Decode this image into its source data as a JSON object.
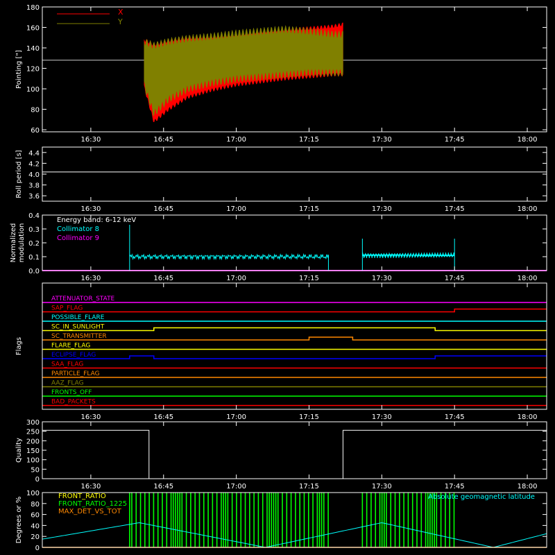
{
  "colors": {
    "background": "#000000",
    "axes": "#ffffff",
    "x_series": "#ff0000",
    "y_series": "#808000",
    "collimator8": "#00ffff",
    "collimator9": "#ff00ff",
    "front_ratio": "#ffff00",
    "front_ratio_1225": "#00ff00",
    "max_det": "#ff8800",
    "geomag": "#00ffff"
  },
  "chart_data": [
    {
      "id": "pointing",
      "type": "line",
      "ylabel": "Pointing [\"]",
      "xlim": [
        "16:20",
        "18:04"
      ],
      "ylim": [
        58,
        180
      ],
      "x_ticks": [
        "16:30",
        "16:45",
        "17:00",
        "17:15",
        "17:30",
        "17:45",
        "18:00"
      ],
      "y_ticks": [
        60,
        80,
        100,
        120,
        140,
        160,
        180
      ],
      "legend": [
        "X",
        "Y"
      ],
      "legend_placement": "top-left",
      "reference_line_y": 128,
      "data_range": [
        "16:41",
        "17:22"
      ],
      "series": [
        {
          "name": "X",
          "color": "#ff0000",
          "x": [
            "16:41",
            "16:43",
            "16:46",
            "16:50",
            "16:55",
            "17:00",
            "17:05",
            "17:10",
            "17:15",
            "17:20",
            "17:22"
          ],
          "upper": [
            150,
            145,
            149,
            152,
            153,
            155,
            158,
            160,
            161,
            163,
            165
          ],
          "lower": [
            100,
            66,
            78,
            90,
            97,
            102,
            105,
            108,
            110,
            112,
            112
          ]
        },
        {
          "name": "Y",
          "color": "#808000",
          "x": [
            "16:41",
            "16:43",
            "16:46",
            "16:50",
            "16:55",
            "17:00",
            "17:05",
            "17:10",
            "17:15",
            "17:20",
            "17:22"
          ],
          "upper": [
            150,
            146,
            150,
            153,
            155,
            158,
            160,
            162,
            160,
            157,
            157
          ],
          "lower": [
            100,
            72,
            86,
            96,
            102,
            106,
            108,
            110,
            112,
            112,
            112
          ]
        }
      ]
    },
    {
      "id": "roll",
      "type": "line",
      "ylabel": "Roll period [s]",
      "xlim": [
        "16:20",
        "18:04"
      ],
      "ylim": [
        3.5,
        4.5
      ],
      "x_ticks": [
        "16:30",
        "16:45",
        "17:00",
        "17:15",
        "17:30",
        "17:45",
        "18:00"
      ],
      "y_ticks": [
        "3.6",
        "3.8",
        "4.0",
        "4.2",
        "4.4"
      ],
      "series": [
        {
          "name": "",
          "x": [
            "16:20",
            "18:04"
          ],
          "values": [
            4.04,
            4.04
          ]
        }
      ]
    },
    {
      "id": "modulation",
      "type": "line",
      "ylabel": "Normalized modulation",
      "xlim": [
        "16:20",
        "18:04"
      ],
      "ylim": [
        0,
        0.4
      ],
      "x_ticks": [
        "16:30",
        "16:45",
        "17:00",
        "17:15",
        "17:30",
        "17:45",
        "18:00"
      ],
      "y_ticks": [
        "0.0",
        "0.1",
        "0.2",
        "0.3",
        "0.4"
      ],
      "annotation": "Energy band: 6-12 keV",
      "legend": [
        "Collimator 8",
        "Collimator 9"
      ],
      "segments": [
        {
          "series": "Collimator 8",
          "start": "16:38",
          "end": "17:19",
          "level": 0.1,
          "spike": 0.33
        },
        {
          "series": "Collimator 8",
          "start": "17:26",
          "end": "17:45",
          "level": 0.11,
          "spike": 0.23
        }
      ],
      "collimator9_level": 0.0
    },
    {
      "id": "flags",
      "type": "line",
      "ylabel": "Flags",
      "xlim": [
        "16:20",
        "18:04"
      ],
      "x_ticks": [
        "16:30",
        "16:45",
        "17:00",
        "17:15",
        "17:30",
        "17:45",
        "18:00"
      ],
      "rows": [
        {
          "name": "ATTENUATOR_STATE",
          "color": "#ff00ff",
          "steps": []
        },
        {
          "name": "SAP_FLAG",
          "color": "#ff0000",
          "steps": [
            [
              "16:38",
              0
            ],
            [
              "17:45",
              1
            ]
          ]
        },
        {
          "name": "POSSIBLE_FLARE",
          "color": "#00ffff",
          "steps": []
        },
        {
          "name": "SC_IN_SUNLIGHT",
          "color": "#ffff00",
          "steps": [
            [
              "16:38",
              0
            ],
            [
              "16:43",
              1
            ],
            [
              "17:41",
              0
            ]
          ]
        },
        {
          "name": "SC_TRANSMITTER",
          "color": "#ff8800",
          "steps": [
            [
              "17:15",
              1
            ],
            [
              "17:24",
              0
            ]
          ]
        },
        {
          "name": "FLARE_FLAG",
          "color": "#ffff00",
          "steps": []
        },
        {
          "name": "ECLIPSE_FLAG",
          "color": "#0000ff",
          "steps": [
            [
              "16:38",
              1
            ],
            [
              "16:43",
              0
            ],
            [
              "17:41",
              1
            ]
          ]
        },
        {
          "name": "SAA_FLAG",
          "color": "#ff0000",
          "steps": []
        },
        {
          "name": "PARTICLE_FLAG",
          "color": "#ff8800",
          "steps": [
            [
              "17:45",
              0
            ]
          ]
        },
        {
          "name": "AAZ_FLAG",
          "color": "#808000",
          "steps": []
        },
        {
          "name": "FRONTS_OFF",
          "color": "#00ff00",
          "steps": []
        },
        {
          "name": "BAD_PACKETS",
          "color": "#ff0000",
          "steps": []
        }
      ]
    },
    {
      "id": "quality",
      "type": "line",
      "ylabel": "Quality",
      "xlim": [
        "16:20",
        "18:04"
      ],
      "ylim": [
        0,
        300
      ],
      "x_ticks": [
        "16:30",
        "16:45",
        "17:00",
        "17:15",
        "17:30",
        "17:45",
        "18:00"
      ],
      "y_ticks": [
        0,
        50,
        100,
        150,
        200,
        250,
        300
      ],
      "steps": [
        [
          "16:20",
          255
        ],
        [
          "16:42",
          0
        ],
        [
          "17:22",
          255
        ],
        [
          "18:04",
          255
        ]
      ]
    },
    {
      "id": "geomag",
      "type": "line",
      "ylabel": "Degrees or %",
      "xlim": [
        "16:20",
        "18:04"
      ],
      "ylim": [
        0,
        100
      ],
      "y_ticks": [
        0,
        20,
        40,
        60,
        80,
        100
      ],
      "legend": [
        "FRONT_RATIO",
        "FRONT_RATIO_1225",
        "MAX_DET_VS_TOT"
      ],
      "right_label": "Absolute geomagnetic latitude",
      "series": [
        {
          "name": "Absolute geomagnetic latitude",
          "x": [
            "16:20",
            "16:40",
            "17:06",
            "17:30",
            "17:53",
            "18:04"
          ],
          "values": [
            15,
            45,
            0,
            45,
            0,
            25
          ]
        }
      ],
      "green_band": [
        [
          "16:38",
          "17:19"
        ],
        [
          "17:26",
          "17:45"
        ]
      ]
    }
  ]
}
